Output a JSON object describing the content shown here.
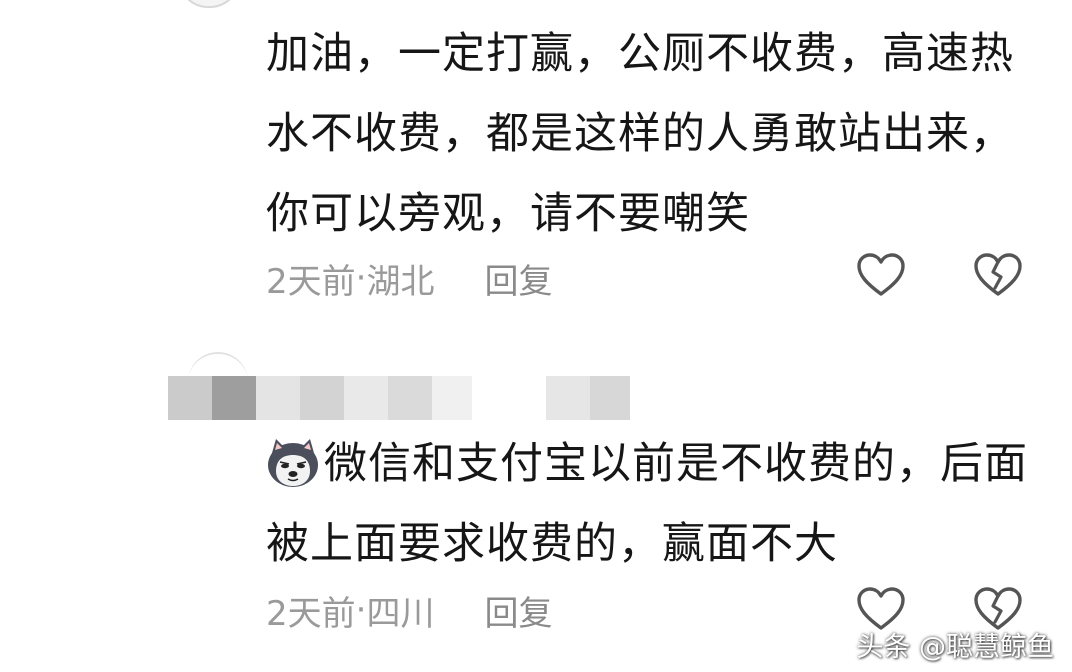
{
  "comments": [
    {
      "text": "加油，一定打赢，公厕不收费，高速热水不收费，都是这样的人勇敢站出来，你可以旁观，请不要嘲笑",
      "time": "2天前",
      "separator": " · ",
      "location": "湖北",
      "reply_label": "回复",
      "like_icon": "heart-outline-icon",
      "dislike_icon": "broken-heart-icon"
    },
    {
      "text": "微信和支付宝以前是不收费的，后面被上面要求收费的，赢面不大",
      "emoji_icon": "husky-dog-emoji-icon",
      "time": "2天前",
      "separator": " · ",
      "location": "四川",
      "reply_label": "回复",
      "like_icon": "heart-outline-icon",
      "dislike_icon": "broken-heart-icon"
    }
  ],
  "colors": {
    "text": "#161616",
    "meta": "#9a9a9a",
    "icon": "#555555",
    "mosaic": [
      "#c9c9c9",
      "#9b9b9b",
      "#e3e3e3",
      "#eeeeee",
      "#d6d6d6",
      "#f1f1f1",
      "#dcdcdc",
      "#cfcfcf"
    ]
  },
  "watermark": "头条 @聪慧鲸鱼"
}
